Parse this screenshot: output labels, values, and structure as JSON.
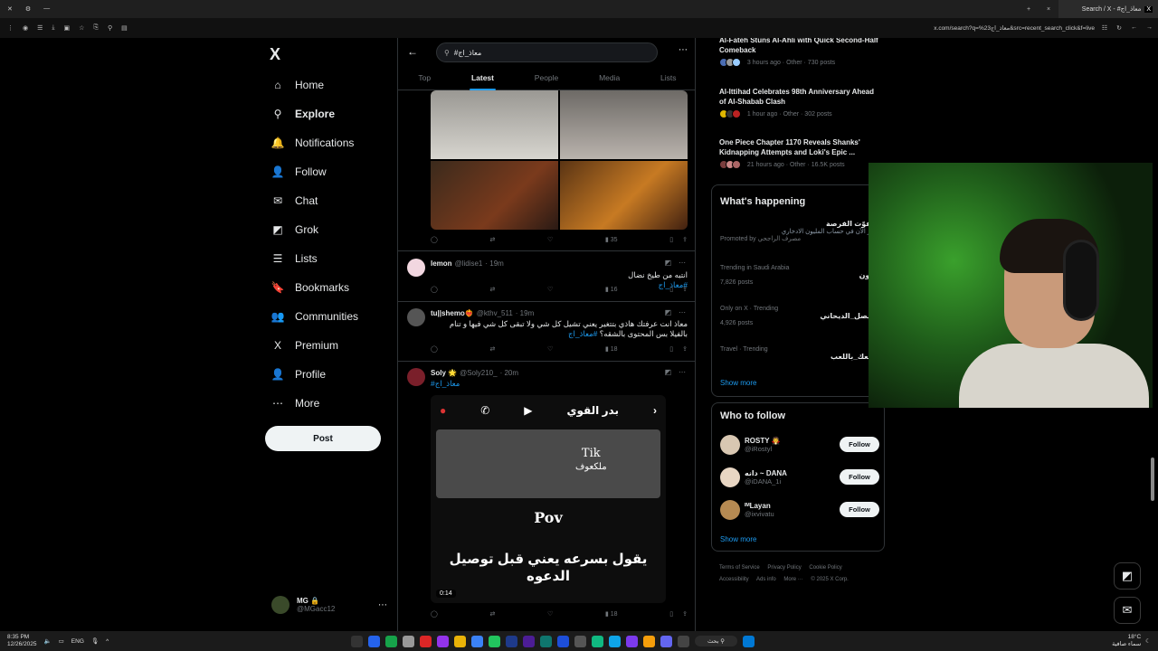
{
  "browser": {
    "tab_title": "Search / X - #معاذ_اج",
    "url": "x.com/search?q=%23معاذ_اج&src=recent_search_click&f=live",
    "new_tab": "+",
    "close": "×"
  },
  "nav": {
    "logo": "X",
    "items": [
      {
        "name": "home",
        "label": "Home",
        "icon": "⌂"
      },
      {
        "name": "explore",
        "label": "Explore",
        "icon": "⚲"
      },
      {
        "name": "notifications",
        "label": "Notifications",
        "icon": "🔔"
      },
      {
        "name": "follow",
        "label": "Follow",
        "icon": "👤"
      },
      {
        "name": "chat",
        "label": "Chat",
        "icon": "✉"
      },
      {
        "name": "grok",
        "label": "Grok",
        "icon": "◩"
      },
      {
        "name": "lists",
        "label": "Lists",
        "icon": "☰"
      },
      {
        "name": "bookmarks",
        "label": "Bookmarks",
        "icon": "🔖"
      },
      {
        "name": "communities",
        "label": "Communities",
        "icon": "👥"
      },
      {
        "name": "premium",
        "label": "Premium",
        "icon": "X"
      },
      {
        "name": "profile",
        "label": "Profile",
        "icon": "👤"
      },
      {
        "name": "more",
        "label": "More",
        "icon": "⋯"
      }
    ],
    "post_label": "Post",
    "account": {
      "name": "MG 🔒",
      "handle": "@MGacc12",
      "more": "⋯"
    }
  },
  "search": {
    "query": "#معاذ_اج",
    "back": "←",
    "more": "⋯"
  },
  "tabs": [
    "Top",
    "Latest",
    "People",
    "Media",
    "Lists"
  ],
  "tweets": [
    {
      "stats": {
        "views": "35"
      }
    },
    {
      "name": "lemon",
      "handle": "@lidise1",
      "time": "· 19m",
      "text": "انتبه من طيخ نضال",
      "hashtag": "#معاذ_اج",
      "views": "16"
    },
    {
      "name": "tu||shemo❤️‍🔥",
      "handle": "@kthv_511",
      "time": "· 19m",
      "text": "معاذ انت عرفتك هاذي بتتغير يعني تشيل كل شي ولا تبقى كل شي فيها و تنام بالفيلا بس المحتوى بالشقه؟",
      "hashtag": "#معاذ_اج",
      "views": "18"
    },
    {
      "name": "Soly 🌟",
      "handle": "@Soly210_",
      "time": "· 20m",
      "hashtag": "#معاذ_اج",
      "views": "18",
      "video": {
        "caller": "بدر القوي",
        "tik": "Tik",
        "tik_sub": "ملكعوف",
        "pov": "Pov",
        "subtitle": "يقول بسرعه يعني قبل توصيل الدعوه",
        "duration": "0:14"
      }
    }
  ],
  "news": [
    {
      "title": "Al-Fateh Stuns Al-Ahli with Quick Second-Half Comeback",
      "meta": "3 hours ago · Other · 730 posts"
    },
    {
      "title": "Al-Ittihad Celebrates 98th Anniversary Ahead of Al-Shabab Clash",
      "meta": "1 hour ago · Other · 302 posts"
    },
    {
      "title": "One Piece Chapter 1170 Reveals Shanks' Kidnapping Attempts and Loki's Epic ...",
      "meta": "21 hours ago · Other · 16.5K posts"
    }
  ],
  "happening": {
    "title": "What's happening",
    "promo": {
      "title": "لاتفوّت الفرصة",
      "desc": "ادخر الآن في حساب المليون الادخاري",
      "by": "Promoted by مصرف الراجحي"
    },
    "trends": [
      {
        "context": "Trending in Saudi Arabia",
        "title": "تعاون",
        "posts": "7,826 posts"
      },
      {
        "context": "Only on X · Trending",
        "title": "#فيصل_الديحاني",
        "posts": "4,926 posts"
      },
      {
        "context": "Travel · Trending",
        "title": "#سعك_باللعب",
        "posts": ""
      }
    ],
    "show_more": "Show more"
  },
  "who_to_follow": {
    "title": "Who to follow",
    "users": [
      {
        "name": "ROSTY 🧛",
        "handle": "@iRostyl",
        "btn": "Follow"
      },
      {
        "name": "دانه ~ DANA",
        "handle": "@iDANA_1i",
        "btn": "Follow"
      },
      {
        "name": "ᴵᴹLayan",
        "handle": "@ixvivatu",
        "btn": "Follow"
      }
    ],
    "show_more": "Show more"
  },
  "footer": [
    "Terms of Service",
    "Privacy Policy",
    "Cookie Policy",
    "Accessibility",
    "Ads info",
    "More ···",
    "© 2025 X Corp."
  ],
  "taskbar": {
    "time": "8:35 PM",
    "date": "12/26/2025",
    "lang": "ENG",
    "weather": "18°C",
    "weather_desc": "سماء صافية",
    "search": "بحث"
  },
  "colors": {
    "accent": "#1d9bf0",
    "bg": "#000000",
    "border": "#2f3336",
    "muted": "#71767b"
  }
}
